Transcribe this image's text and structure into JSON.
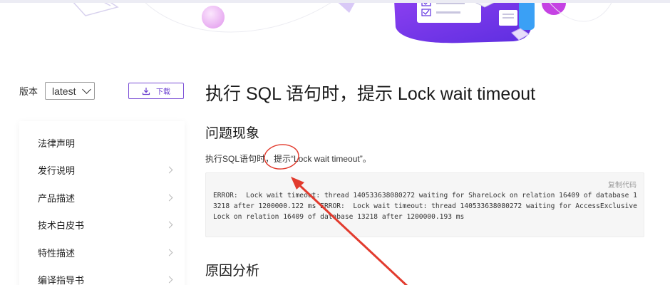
{
  "version": {
    "label": "版本",
    "selected": "latest"
  },
  "download": {
    "label": "下载"
  },
  "sidebar": {
    "items": [
      {
        "label": "法律声明",
        "has_children": false
      },
      {
        "label": "发行说明",
        "has_children": true
      },
      {
        "label": "产品描述",
        "has_children": true
      },
      {
        "label": "技术白皮书",
        "has_children": true
      },
      {
        "label": "特性描述",
        "has_children": true
      },
      {
        "label": "编译指导书",
        "has_children": true
      }
    ]
  },
  "article": {
    "title": "执行 SQL 语句时，提示 Lock wait timeout",
    "section1_heading": "问题现象",
    "paragraph": "执行SQL语句时，提示“Lock wait timeout”。",
    "code": {
      "copy_label": "复制代码",
      "text": "ERROR:  Lock wait timeout: thread 140533638080272 waiting for ShareLock on relation 16409 of database 13218 after 1200000.122 ms ERROR:  Lock wait timeout: thread 140533638080272 waiting for AccessExclusiveLock on relation 16409 of database 13218 after 1200000.193 ms"
    },
    "section2_heading": "原因分析"
  },
  "colors": {
    "accent": "#6b3fd0",
    "annotation": "#e23b2e",
    "banner_purple": "#7b3ff0",
    "banner_pink": "#f0b7f5"
  },
  "icons": {
    "download": "download-icon",
    "chevron": "chevron-down-icon",
    "side_chevron": "chevron-right-icon"
  }
}
